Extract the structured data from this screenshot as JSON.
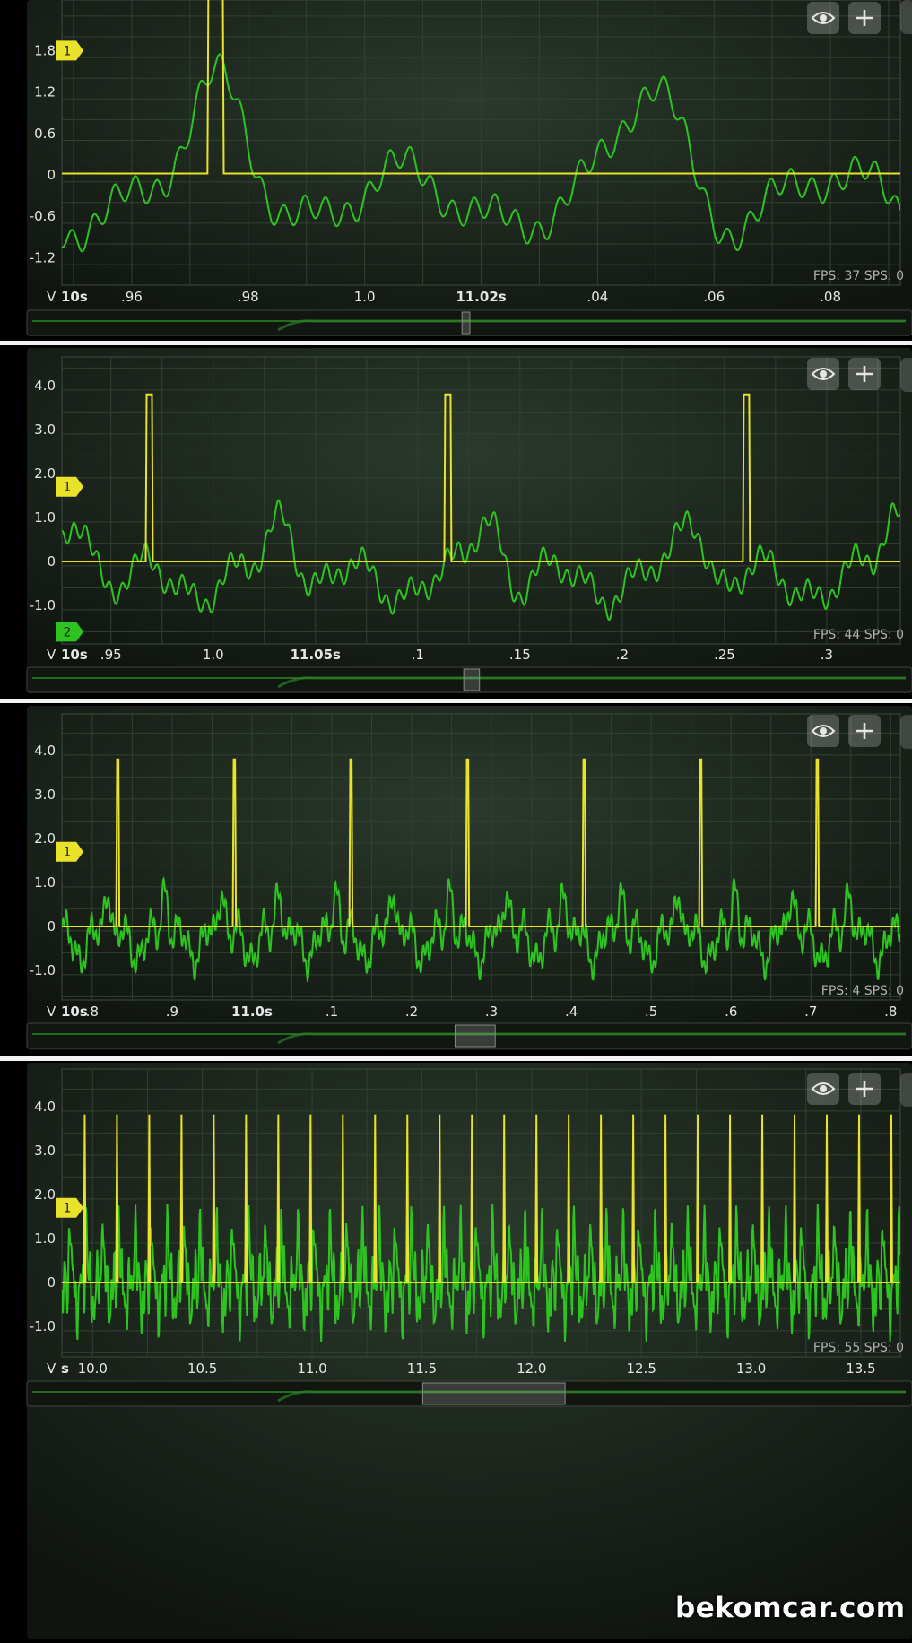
{
  "colors": {
    "ch1": "#e8e22a",
    "ch2": "#2ec41f",
    "text": "#e6e6e6",
    "stats": "#b0b0b0"
  },
  "icons": {
    "visibility": "eye-icon",
    "add": "plus-icon"
  },
  "chart_data": [
    {
      "type": "line",
      "ylim": [
        -1.6,
        2.6
      ],
      "y_ticks": [
        "1.8",
        "1.2",
        "0.6",
        "0",
        "-0.6",
        "-1.2"
      ],
      "y_tick_values": [
        1.8,
        1.2,
        0.6,
        0,
        -0.6,
        -1.2
      ],
      "x_unit_label": "V",
      "x_major_label": "10s",
      "x_ticks": [
        ".96",
        ".98",
        "1.0",
        "11.02s",
        ".04",
        ".06",
        ".08"
      ],
      "x_tick_values": [
        10.96,
        10.98,
        11.0,
        11.02,
        11.04,
        11.06,
        11.08
      ],
      "x_bold_tick": "11.02s",
      "xlim": [
        10.948,
        11.092
      ],
      "channel_markers": [
        "1"
      ],
      "marker_values": [
        1.8
      ],
      "stats": "FPS: 37  SPS: 0",
      "series": [
        {
          "channel": "1",
          "kind": "pulse",
          "baseline": 0.02,
          "peak": 2.6,
          "pulse_width": 0.0028,
          "pulse_times": [
            10.973
          ]
        },
        {
          "channel": "2",
          "kind": "wave",
          "amplitude": 1.0,
          "offset": 0.0,
          "cycles_per_second": 27,
          "detail": 6
        }
      ],
      "scroll_thumb": [
        0.492,
        0.501
      ]
    },
    {
      "type": "line",
      "ylim": [
        -1.6,
        4.5
      ],
      "y_ticks": [
        "4.0",
        "3.0",
        "2.0",
        "1.0",
        "0",
        "-1.0"
      ],
      "y_tick_values": [
        4.0,
        3.0,
        2.0,
        1.0,
        0,
        -1.0
      ],
      "x_unit_label": "V",
      "x_major_label": "10s",
      "x_ticks": [
        ".95",
        "1.0",
        "11.05s",
        ".1",
        ".15",
        ".2",
        ".25",
        ".3"
      ],
      "x_tick_values": [
        10.95,
        11.0,
        11.05,
        11.1,
        11.15,
        11.2,
        11.25,
        11.3
      ],
      "x_bold_tick": "11.05s",
      "xlim": [
        10.926,
        11.336
      ],
      "channel_markers": [
        "1",
        "2"
      ],
      "marker_values": [
        1.7,
        -1.6
      ],
      "stats": "FPS: 44  SPS: 0",
      "series": [
        {
          "channel": "1",
          "kind": "pulse",
          "baseline": 0.0,
          "peak": 3.8,
          "pulse_width": 0.0035,
          "pulse_times": [
            10.967,
            11.113,
            11.259
          ]
        },
        {
          "channel": "2",
          "kind": "wave",
          "amplitude": 1.1,
          "offset": -0.1,
          "cycles_per_second": 20,
          "detail": 5
        }
      ],
      "scroll_thumb": [
        0.494,
        0.512
      ]
    },
    {
      "type": "line",
      "ylim": [
        -1.6,
        4.5
      ],
      "y_ticks": [
        "4.0",
        "3.0",
        "2.0",
        "1.0",
        "0",
        "-1.0"
      ],
      "y_tick_values": [
        4.0,
        3.0,
        2.0,
        1.0,
        0,
        -1.0
      ],
      "x_unit_label": "V",
      "x_major_label": "10s",
      "x_ticks": [
        ".8",
        ".9",
        "11.0s",
        ".1",
        ".2",
        ".3",
        ".4",
        ".5",
        ".6",
        ".7",
        ".8"
      ],
      "x_tick_values": [
        10.8,
        10.9,
        11.0,
        11.1,
        11.2,
        11.3,
        11.4,
        11.5,
        11.6,
        11.7,
        11.8
      ],
      "x_bold_tick": "11.0s",
      "xlim": [
        10.762,
        11.812
      ],
      "channel_markers": [
        "1"
      ],
      "marker_values": [
        1.7
      ],
      "stats": "FPS: 4  SPS: 0",
      "series": [
        {
          "channel": "1",
          "kind": "pulse",
          "baseline": 0.0,
          "peak": 3.8,
          "pulse_width": 0.004,
          "pulse_times": [
            10.83,
            10.976,
            11.122,
            11.268,
            11.414,
            11.56,
            11.706
          ]
        },
        {
          "channel": "2",
          "kind": "wave",
          "amplitude": 1.05,
          "offset": -0.05,
          "cycles_per_second": 28,
          "detail": 4
        }
      ],
      "scroll_thumb": [
        0.484,
        0.53
      ]
    },
    {
      "type": "line",
      "ylim": [
        -1.6,
        4.5
      ],
      "y_ticks": [
        "4.0",
        "3.0",
        "2.0",
        "1.0",
        "0",
        "-1.0"
      ],
      "y_tick_values": [
        4.0,
        3.0,
        2.0,
        1.0,
        0,
        -1.0
      ],
      "x_unit_label": "V",
      "x_major_label": "s",
      "x_ticks": [
        "10.0",
        "10.5",
        "11.0",
        "11.5",
        "12.0",
        "12.5",
        "13.0",
        "13.5"
      ],
      "x_tick_values": [
        10.0,
        10.5,
        11.0,
        11.5,
        12.0,
        12.5,
        13.0,
        13.5
      ],
      "x_bold_tick": "",
      "xlim": [
        9.86,
        13.68
      ],
      "channel_markers": [
        "1"
      ],
      "marker_values": [
        1.7
      ],
      "stats": "FPS: 55  SPS: 0",
      "series": [
        {
          "channel": "1",
          "kind": "pulse",
          "baseline": 0.0,
          "peak": 3.8,
          "pulse_width": 0.008,
          "pulse_times": [
            9.96,
            10.107,
            10.254,
            10.401,
            10.548,
            10.695,
            10.842,
            10.989,
            11.136,
            11.283,
            11.43,
            11.577,
            11.724,
            11.871,
            12.018,
            12.165,
            12.312,
            12.459,
            12.606,
            12.753,
            12.9,
            13.047,
            13.194,
            13.341,
            13.488,
            13.635
          ]
        },
        {
          "channel": "2",
          "kind": "wave",
          "amplitude": 1.4,
          "offset": 0.1,
          "cycles_per_second": 27,
          "detail": 2
        }
      ],
      "scroll_thumb": [
        0.447,
        0.61
      ]
    }
  ],
  "watermark": "bekomcar.com"
}
